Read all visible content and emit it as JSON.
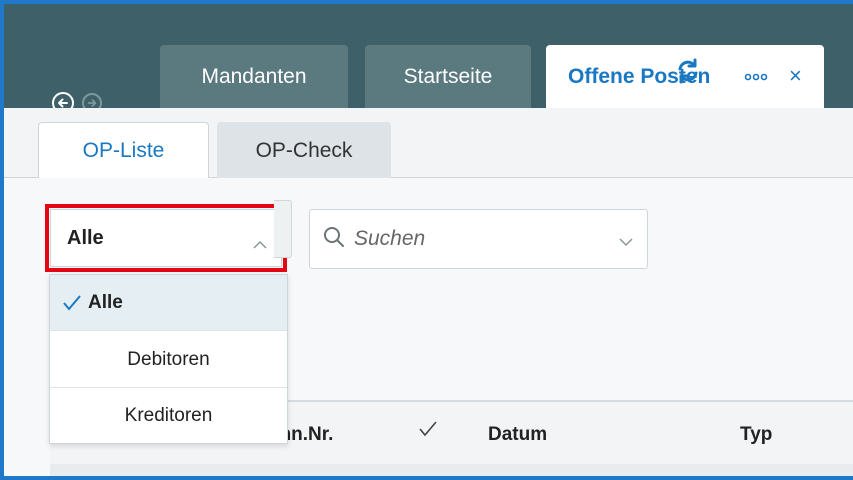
{
  "tabs": [
    {
      "label": "Mandanten"
    },
    {
      "label": "Startseite"
    },
    {
      "label": "Offene Posten",
      "close": "×"
    }
  ],
  "subtabs": [
    {
      "label": "OP-Liste"
    },
    {
      "label": "OP-Check"
    }
  ],
  "filter": {
    "selected": "Alle",
    "options": [
      "Alle",
      "Debitoren",
      "Kreditoren"
    ]
  },
  "search": {
    "placeholder": "Suchen"
  },
  "table": {
    "columns": [
      "chn.Nr.",
      "Datum",
      "Typ"
    ]
  },
  "colors": {
    "accent": "#1a78c2",
    "topbar": "#3e6169",
    "highlight": "#e30613"
  }
}
